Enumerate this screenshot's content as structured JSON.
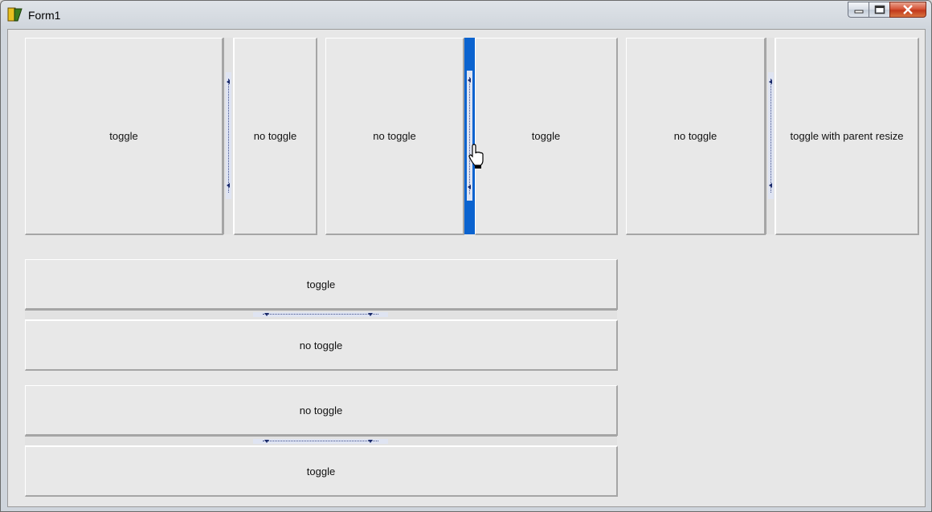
{
  "window": {
    "title": "Form1"
  },
  "top_row": {
    "group1": {
      "left_label": "toggle",
      "right_label": "no toggle"
    },
    "group2": {
      "left_label": "no toggle",
      "right_label": "toggle"
    },
    "group3": {
      "left_label": "no toggle",
      "right_label": "toggle with parent resize"
    }
  },
  "bottom_groups": {
    "group4": {
      "top_label": "toggle",
      "bottom_label": "no toggle"
    },
    "group5": {
      "top_label": "no toggle",
      "bottom_label": "toggle"
    }
  },
  "colors": {
    "active_splitter": "#0b63cf",
    "close_button": "#c1391b"
  },
  "icons": [
    "app-icon",
    "minimize-icon",
    "maximize-icon",
    "close-icon",
    "collapse-arrow-icon",
    "hand-cursor-icon"
  ]
}
